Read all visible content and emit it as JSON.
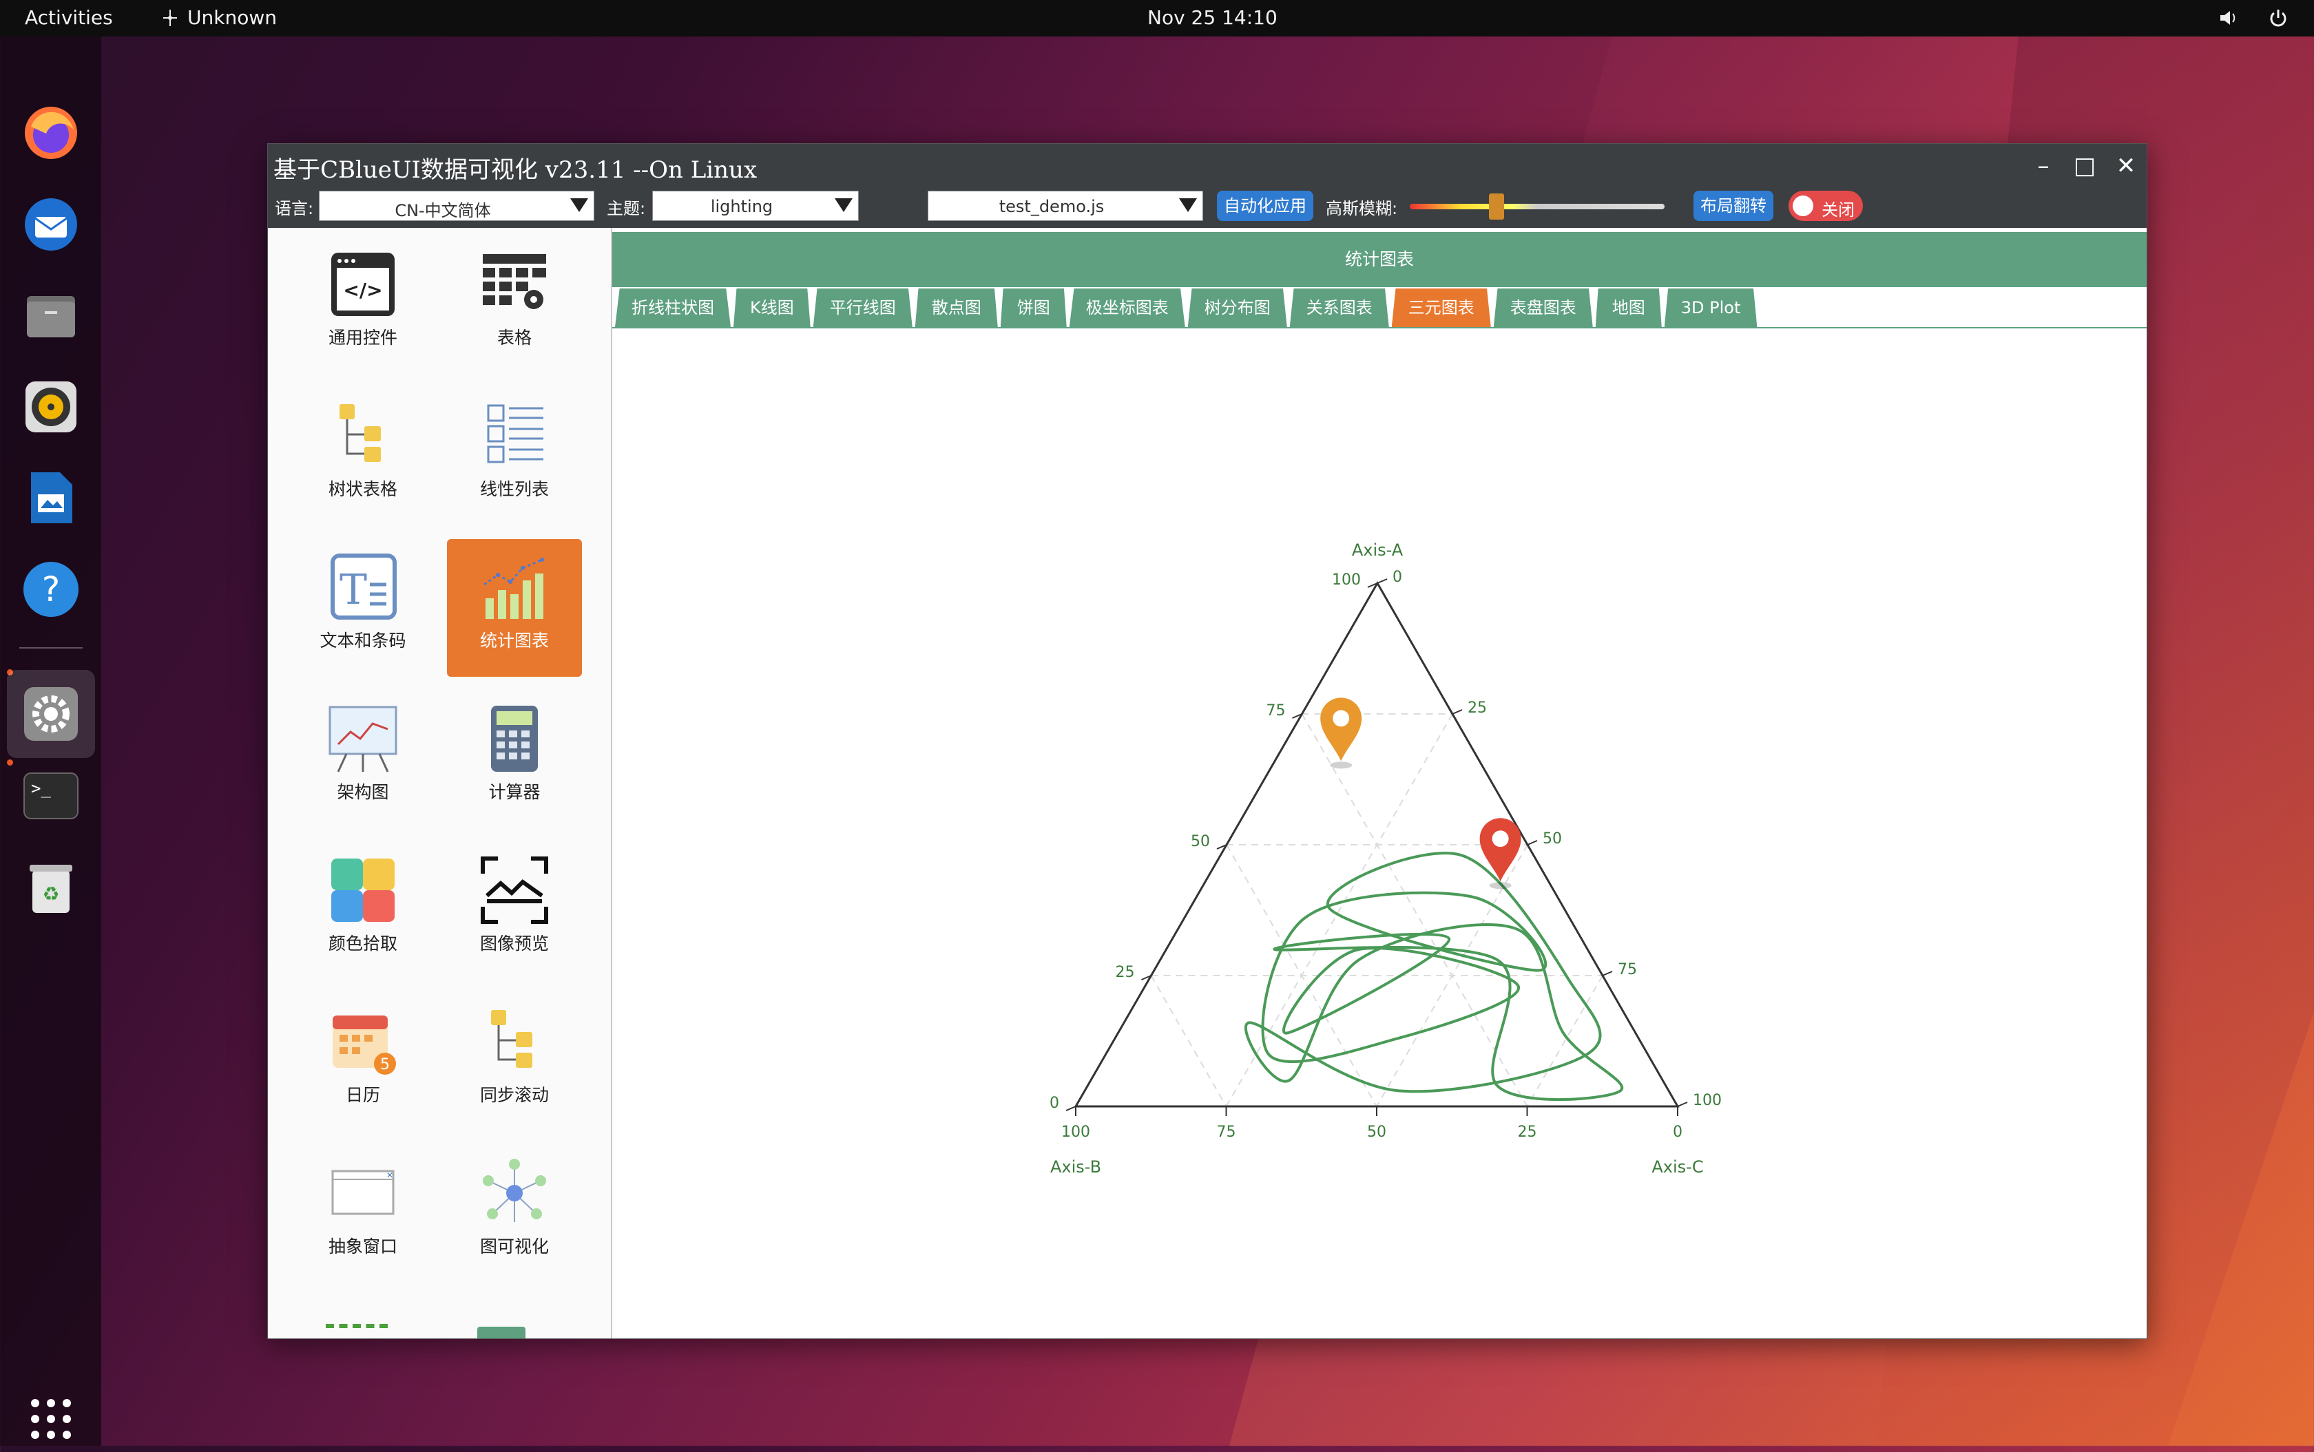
{
  "topbar": {
    "activities": "Activities",
    "app_name": "Unknown",
    "datetime": "Nov 25  14:10"
  },
  "dock": {
    "items": [
      "firefox-icon",
      "thunderbird-icon",
      "files-icon",
      "rhythmbox-icon",
      "writer-icon",
      "help-icon",
      "settings-icon",
      "terminal-icon",
      "trash-icon",
      "app-grid-icon"
    ]
  },
  "window": {
    "title": "基于CBlueUI数据可视化 v23.11 --On Linux",
    "toolbar": {
      "lang_label": "语言:",
      "lang_value": "CN-中文简体",
      "theme_label": "主题:",
      "theme_value": "lighting",
      "script_value": "test_demo.js",
      "auto_apply": "自动化应用",
      "blur_label": "高斯模糊:",
      "blur_level": 0.33,
      "layout_flip": "布局翻转",
      "toggle_label": "关闭"
    }
  },
  "sidebar": {
    "items": [
      {
        "label": "通用控件",
        "icon": "code-window-icon"
      },
      {
        "label": "表格",
        "icon": "table-gear-icon"
      },
      {
        "label": "树状表格",
        "icon": "tree-table-icon"
      },
      {
        "label": "线性列表",
        "icon": "linear-list-icon"
      },
      {
        "label": "文本和条码",
        "icon": "text-barcode-icon"
      },
      {
        "label": "统计图表",
        "icon": "bar-chart-icon",
        "active": true
      },
      {
        "label": "架构图",
        "icon": "easel-chart-icon"
      },
      {
        "label": "计算器",
        "icon": "calculator-icon"
      },
      {
        "label": "颜色拾取",
        "icon": "color-picker-icon"
      },
      {
        "label": "图像预览",
        "icon": "image-preview-icon"
      },
      {
        "label": "日历",
        "icon": "calendar-icon"
      },
      {
        "label": "同步滚动",
        "icon": "sync-scroll-icon"
      },
      {
        "label": "抽象窗口",
        "icon": "abstract-window-icon"
      },
      {
        "label": "图可视化",
        "icon": "graph-visual-icon"
      }
    ]
  },
  "main": {
    "header": "统计图表",
    "tabs": [
      "折线柱状图",
      "K线图",
      "平行线图",
      "散点图",
      "饼图",
      "极坐标图表",
      "树分布图",
      "关系图表",
      "三元图表",
      "表盘图表",
      "地图",
      "3D Plot"
    ],
    "active_tab": "三元图表"
  },
  "chart_data": {
    "type": "ternary",
    "axes": {
      "a": {
        "label": "Axis-A",
        "ticks": [
          "100",
          "75",
          "50",
          "25",
          "0"
        ]
      },
      "b": {
        "label": "Axis-B",
        "ticks": [
          "100",
          "75",
          "50",
          "25",
          "0"
        ]
      },
      "c": {
        "label": "Axis-C",
        "ticks": [
          "0",
          "25",
          "50",
          "75",
          "100"
        ]
      }
    },
    "grid": true,
    "line_color": "#4a9a58",
    "markers": [
      {
        "name": "orange-marker",
        "a": 66,
        "b": 23,
        "c": 11,
        "color": "#e8982c"
      },
      {
        "name": "red-marker",
        "a": 43,
        "b": 8,
        "c": 49,
        "color": "#e04836"
      }
    ],
    "series": [
      {
        "values": [
          {
            "a": 38,
            "b": 39,
            "c": 23
          },
          {
            "a": 48,
            "b": 12,
            "c": 40
          },
          {
            "a": 24,
            "b": 6,
            "c": 70
          },
          {
            "a": 10,
            "b": 10,
            "c": 80
          },
          {
            "a": 3,
            "b": 45,
            "c": 52
          },
          {
            "a": 16,
            "b": 63,
            "c": 21
          },
          {
            "a": 5,
            "b": 62,
            "c": 33
          },
          {
            "a": 28,
            "b": 39,
            "c": 33
          },
          {
            "a": 34,
            "b": 10,
            "c": 56
          },
          {
            "a": 14,
            "b": 12,
            "c": 74
          },
          {
            "a": 3,
            "b": 8,
            "c": 89
          },
          {
            "a": 4,
            "b": 28,
            "c": 68
          },
          {
            "a": 28,
            "b": 16,
            "c": 56
          },
          {
            "a": 30,
            "b": 52,
            "c": 18
          },
          {
            "a": 32,
            "b": 22,
            "c": 46
          },
          {
            "a": 14,
            "b": 58,
            "c": 28
          },
          {
            "a": 30,
            "b": 38,
            "c": 32
          },
          {
            "a": 23,
            "b": 15,
            "c": 62
          },
          {
            "a": 13,
            "b": 40,
            "c": 47
          },
          {
            "a": 10,
            "b": 63,
            "c": 27
          },
          {
            "a": 36,
            "b": 44,
            "c": 20
          },
          {
            "a": 40,
            "b": 14,
            "c": 46
          },
          {
            "a": 26,
            "b": 10,
            "c": 64
          }
        ]
      }
    ]
  }
}
